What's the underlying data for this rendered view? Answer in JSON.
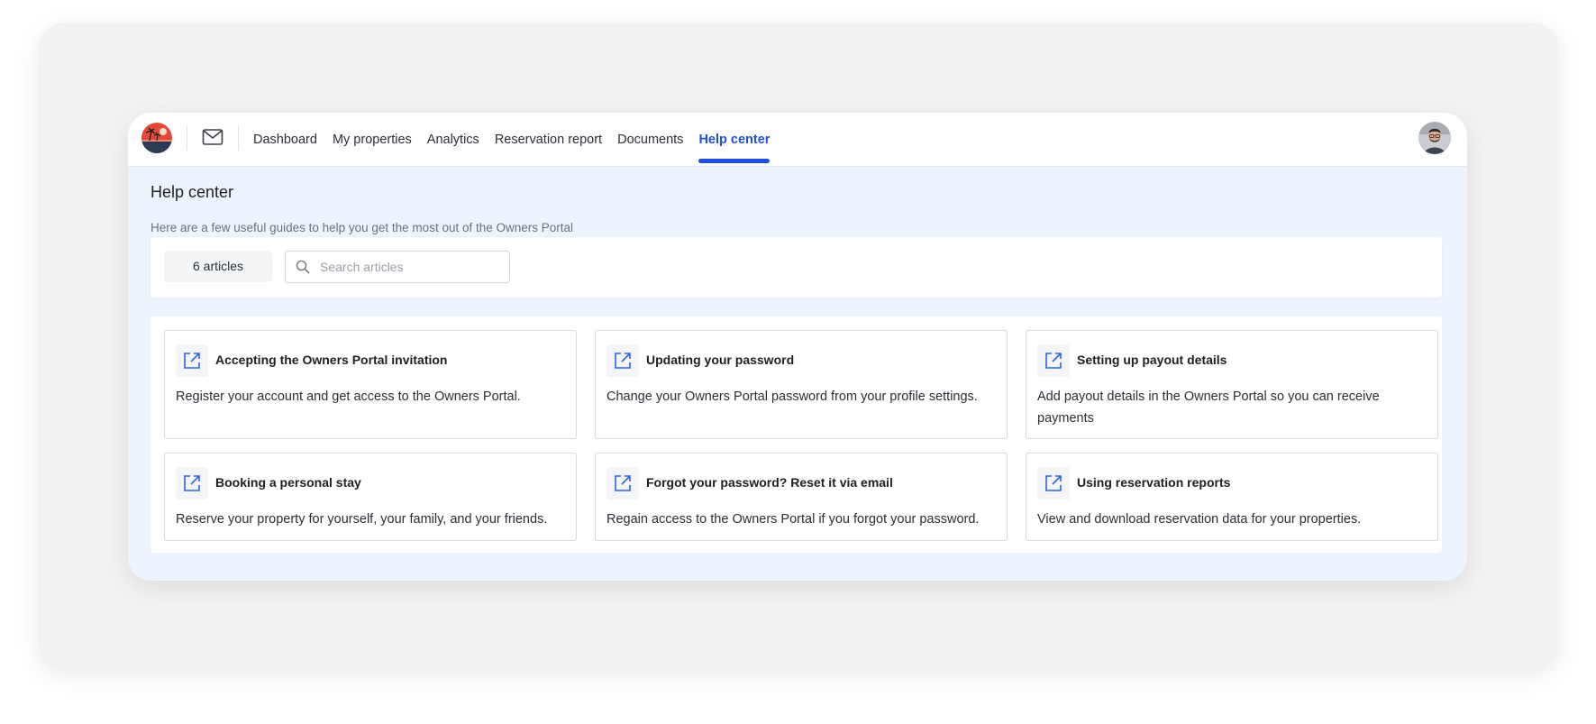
{
  "nav": {
    "items": [
      {
        "label": "Dashboard",
        "name": "nav-dashboard",
        "active": false
      },
      {
        "label": "My properties",
        "name": "nav-my-properties",
        "active": false
      },
      {
        "label": "Analytics",
        "name": "nav-analytics",
        "active": false
      },
      {
        "label": "Reservation report",
        "name": "nav-reservation-report",
        "active": false
      },
      {
        "label": "Documents",
        "name": "nav-documents",
        "active": false
      },
      {
        "label": "Help center",
        "name": "nav-help-center",
        "active": true
      }
    ],
    "accent_color": "#1f4fdc"
  },
  "page": {
    "title": "Help center",
    "subtitle": "Here are a few useful guides to help you get the most out of the Owners Portal"
  },
  "toolbar": {
    "count_label": "6 articles",
    "search_placeholder": "Search articles",
    "search_value": ""
  },
  "articles": [
    {
      "title": "Accepting the Owners Portal invitation",
      "description": "Register your account and get access to the Owners Portal.",
      "icon": "external-link-icon"
    },
    {
      "title": "Updating your password",
      "description": "Change your Owners Portal password from your profile settings.",
      "icon": "external-link-icon"
    },
    {
      "title": "Setting up payout details",
      "description": "Add payout details in the Owners Portal so you can receive payments",
      "icon": "external-link-icon"
    },
    {
      "title": "Booking a personal stay",
      "description": "Reserve your property for yourself, your family, and your friends.",
      "icon": "external-link-icon"
    },
    {
      "title": "Forgot your password? Reset it via email",
      "description": "Regain access to the Owners Portal if you forgot your password.",
      "icon": "external-link-icon"
    },
    {
      "title": "Using reservation reports",
      "description": "View and download reservation data for your properties.",
      "icon": "external-link-icon"
    }
  ],
  "icons": {
    "logo": "beach-logo-icon",
    "mail": "mail-icon",
    "avatar": "user-avatar",
    "search": "search-icon"
  }
}
